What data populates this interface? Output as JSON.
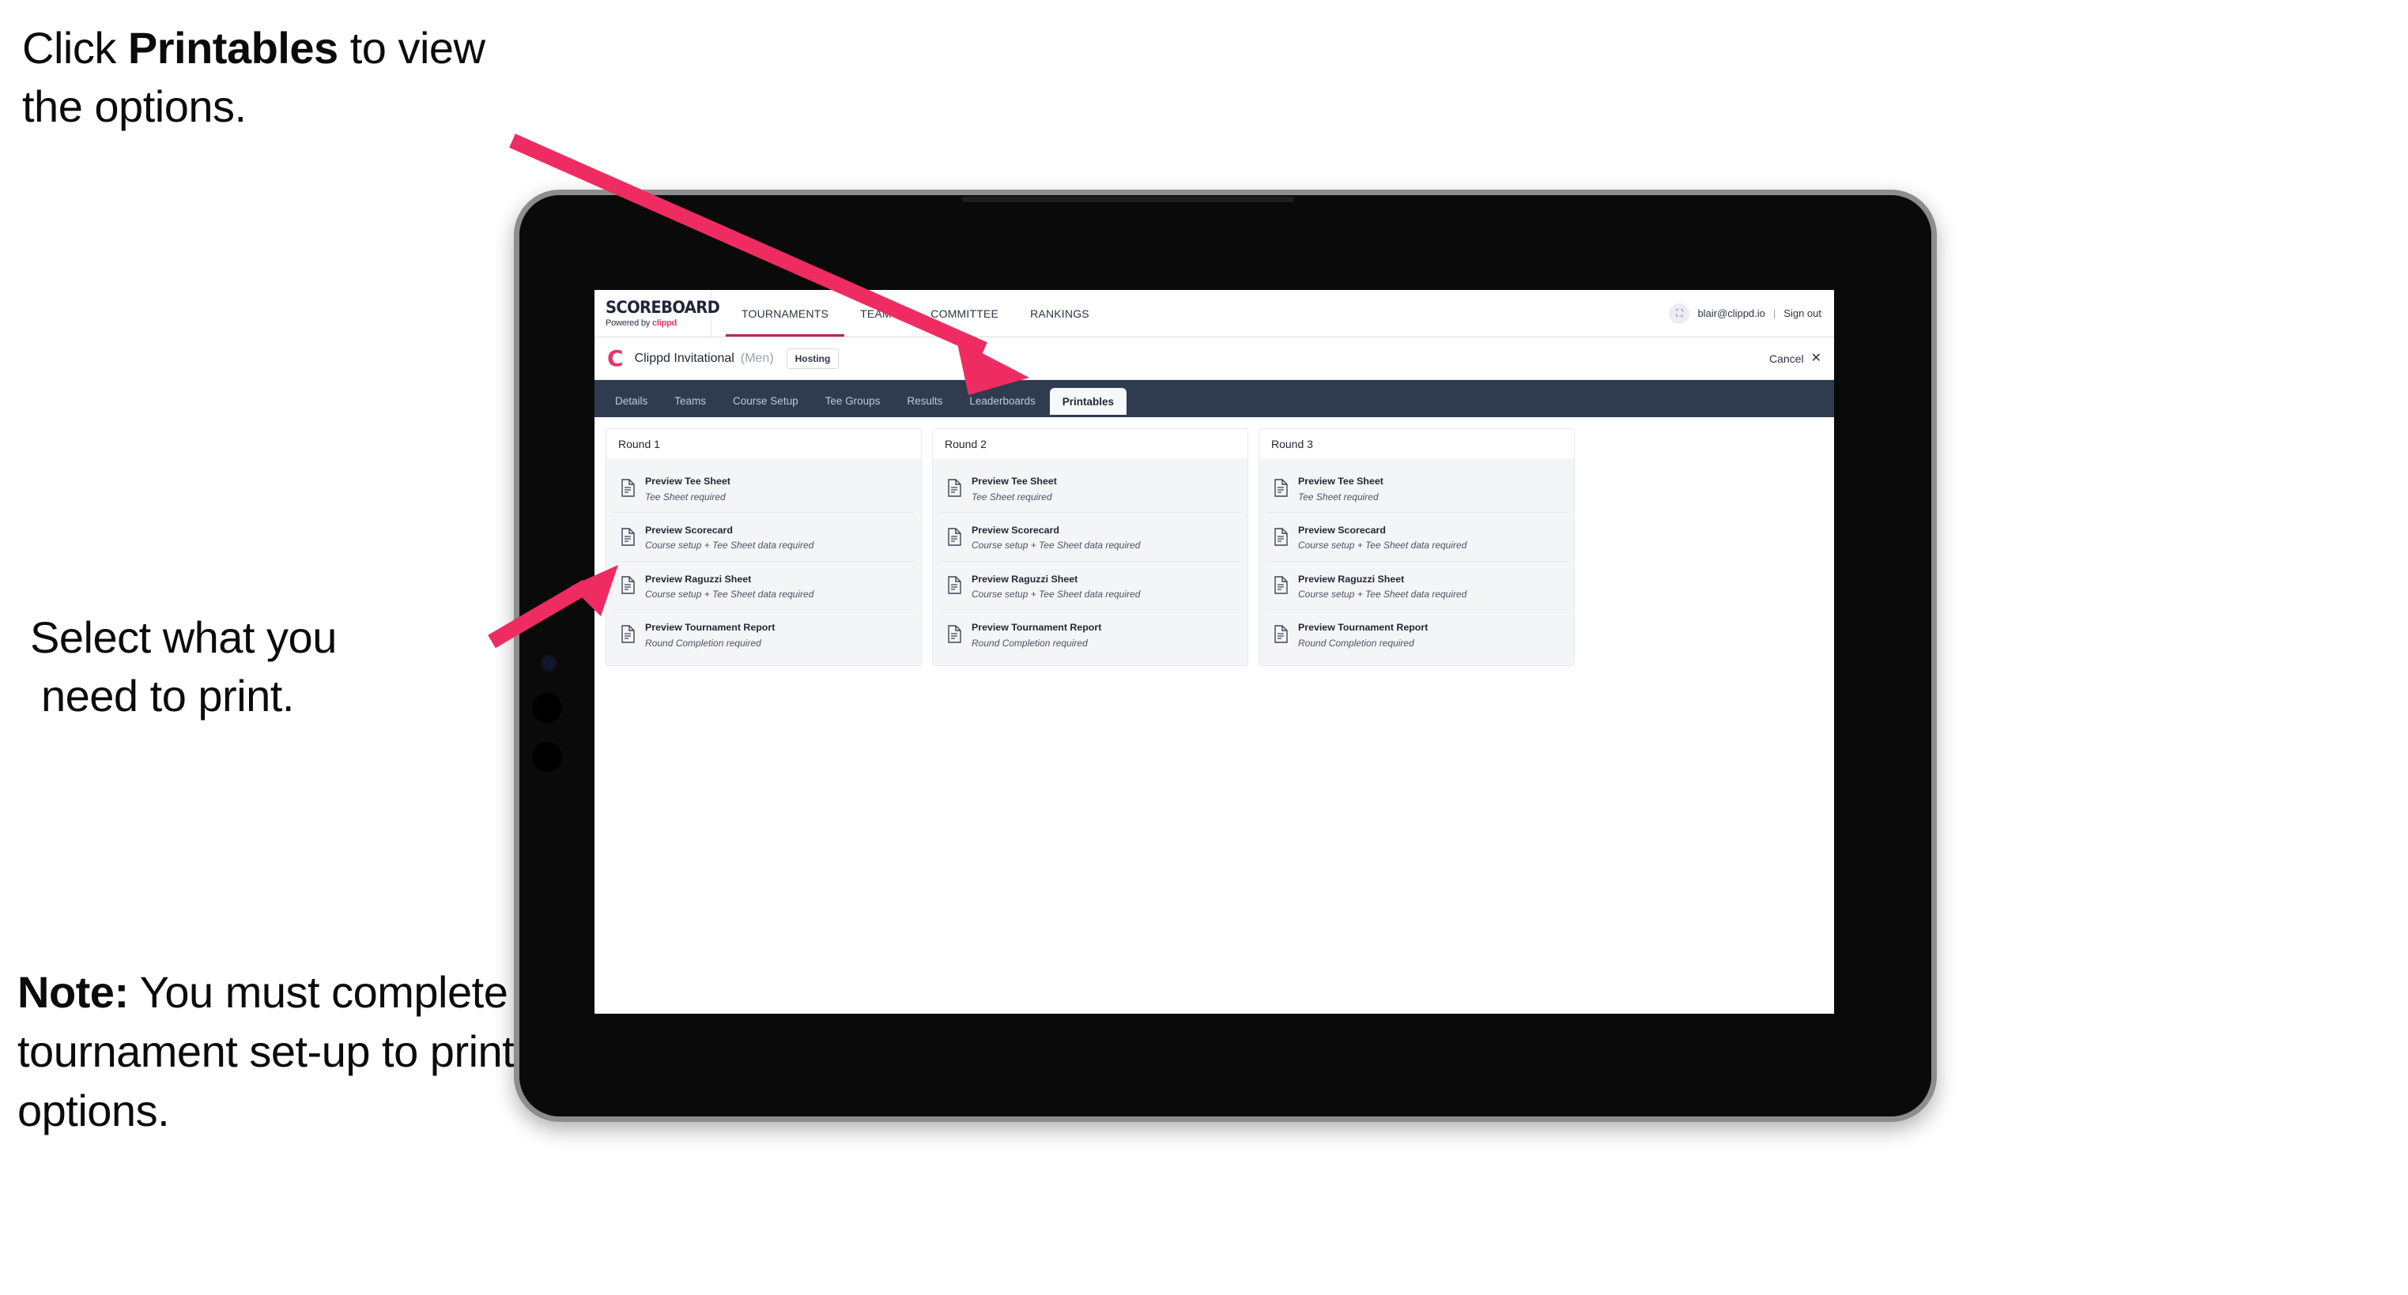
{
  "annotations": {
    "callout_1": {
      "prefix": "Click ",
      "bold": "Printables",
      "suffix": " to view the options."
    },
    "callout_2": {
      "line1": "Select what you",
      "line2": "need to print."
    },
    "callout_3": {
      "bold": "Note:",
      "text": " You must complete the tournament set-up to print all the options."
    },
    "arrow_color": "#ef2c62"
  },
  "app": {
    "brand": {
      "title": "SCOREBOARD",
      "powered_by": "Powered by ",
      "powered_by_brand": "clippd"
    },
    "main_menu": [
      {
        "label": "TOURNAMENTS",
        "active": true
      },
      {
        "label": "TEAMS",
        "active": false
      },
      {
        "label": "COMMITTEE",
        "active": false
      },
      {
        "label": "RANKINGS",
        "active": false
      }
    ],
    "nav_right": {
      "avatar_icon": "user-avatar-icon",
      "avatar_glyph": "⛶",
      "email": "blair@clippd.io",
      "separator": "|",
      "sign_out": "Sign out"
    },
    "tournament": {
      "logo_glyph": "C",
      "name": "Clippd Invitational",
      "gender": "(Men)",
      "badge": "Hosting",
      "cancel_label": "Cancel",
      "cancel_icon": "close-x-icon",
      "cancel_glyph": "✕"
    },
    "tabs": [
      {
        "label": "Details",
        "active": false
      },
      {
        "label": "Teams",
        "active": false
      },
      {
        "label": "Course Setup",
        "active": false
      },
      {
        "label": "Tee Groups",
        "active": false
      },
      {
        "label": "Results",
        "active": false
      },
      {
        "label": "Leaderboards",
        "active": false
      },
      {
        "label": "Printables",
        "active": true
      }
    ],
    "rounds": [
      {
        "title": "Round 1",
        "items": [
          {
            "title": "Preview Tee Sheet",
            "requirement": "Tee Sheet required"
          },
          {
            "title": "Preview Scorecard",
            "requirement": "Course setup + Tee Sheet data required"
          },
          {
            "title": "Preview Raguzzi Sheet",
            "requirement": "Course setup + Tee Sheet data required"
          },
          {
            "title": "Preview Tournament Report",
            "requirement": "Round Completion required"
          }
        ]
      },
      {
        "title": "Round 2",
        "items": [
          {
            "title": "Preview Tee Sheet",
            "requirement": "Tee Sheet required"
          },
          {
            "title": "Preview Scorecard",
            "requirement": "Course setup + Tee Sheet data required"
          },
          {
            "title": "Preview Raguzzi Sheet",
            "requirement": "Course setup + Tee Sheet data required"
          },
          {
            "title": "Preview Tournament Report",
            "requirement": "Round Completion required"
          }
        ]
      },
      {
        "title": "Round 3",
        "items": [
          {
            "title": "Preview Tee Sheet",
            "requirement": "Tee Sheet required"
          },
          {
            "title": "Preview Scorecard",
            "requirement": "Course setup + Tee Sheet data required"
          },
          {
            "title": "Preview Raguzzi Sheet",
            "requirement": "Course setup + Tee Sheet data required"
          },
          {
            "title": "Preview Tournament Report",
            "requirement": "Round Completion required"
          }
        ]
      }
    ],
    "colors": {
      "brand_pink": "#e8336b",
      "tab_bar": "#2f3b4f",
      "active_underline": "#b3295a",
      "row_bg": "#f4f5f7"
    }
  }
}
